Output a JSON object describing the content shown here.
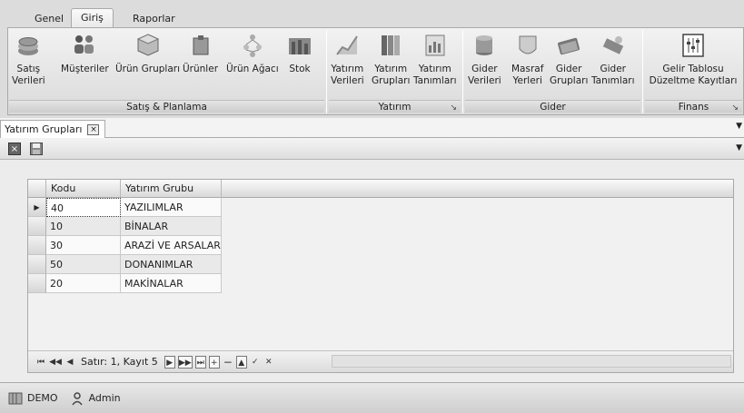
{
  "ribbon_tabs": [
    "Genel",
    "Giriş",
    "Raporlar"
  ],
  "ribbon_active_tab": "Giriş",
  "groups": {
    "satis": {
      "label": "Satış & Planlama",
      "buttons": [
        {
          "line1": "Satış",
          "line2": "Verileri",
          "icon": "coins-icon"
        },
        {
          "line1": "Müşteriler",
          "line2": "",
          "icon": "customers-icon"
        },
        {
          "line1": "Ürün Grupları",
          "line2": "",
          "icon": "product-groups-icon"
        },
        {
          "line1": "Ürünler",
          "line2": "",
          "icon": "products-icon"
        },
        {
          "line1": "Ürün Ağacı",
          "line2": "",
          "icon": "product-tree-icon"
        },
        {
          "line1": "Stok",
          "line2": "",
          "icon": "stock-icon"
        }
      ]
    },
    "yatirim": {
      "label": "Yatırım",
      "buttons": [
        {
          "line1": "Yatırım",
          "line2": "Verileri",
          "icon": "investment-chart-icon"
        },
        {
          "line1": "Yatırım",
          "line2": "Grupları",
          "icon": "investment-groups-icon"
        },
        {
          "line1": "Yatırım",
          "line2": "Tanımları",
          "icon": "investment-definitions-icon"
        }
      ]
    },
    "gider": {
      "label": "Gider",
      "buttons": [
        {
          "line1": "Gider",
          "line2": "Verileri",
          "icon": "expense-data-icon"
        },
        {
          "line1": "Masraf",
          "line2": "Yerleri",
          "icon": "cost-centers-icon"
        },
        {
          "line1": "Gider",
          "line2": "Grupları",
          "icon": "expense-groups-icon"
        },
        {
          "line1": "Gider",
          "line2": "Tanımları",
          "icon": "expense-definitions-icon"
        }
      ]
    },
    "finans": {
      "label": "Finans",
      "buttons": [
        {
          "line1": "Gelir Tablosu",
          "line2": "Düzeltme Kayıtları",
          "icon": "income-statement-icon"
        }
      ]
    }
  },
  "document_tab": {
    "title": "Yatırım Grupları",
    "close_glyph": "×"
  },
  "toolbar": {
    "close_glyph": "×"
  },
  "grid": {
    "columns": [
      "Kodu",
      "Yatırım Grubu"
    ],
    "rows": [
      {
        "kodu": "40",
        "grup": "YAZILIMLAR"
      },
      {
        "kodu": "10",
        "grup": "BİNALAR"
      },
      {
        "kodu": "30",
        "grup": "ARAZİ VE ARSALAR"
      },
      {
        "kodu": "50",
        "grup": "DONANIMLAR"
      },
      {
        "kodu": "20",
        "grup": "MAKİNALAR"
      }
    ],
    "current_row_marker": "▶"
  },
  "navigator": {
    "record_info": "Satır: 1, Kayıt 5",
    "first": "⏮",
    "prev_page": "◀◀",
    "prev": "◀",
    "next": "▶",
    "next_page": "▶▶",
    "last": "⏭",
    "append": "+",
    "delete": "−",
    "edit": "▲",
    "post": "✓",
    "cancel": "✕"
  },
  "status": {
    "company": "DEMO",
    "user": "Admin"
  },
  "colors": {
    "background": "#dcdcdc",
    "ribbon": "#e8e8e8",
    "grid_alt_row": "#e9e9e9"
  }
}
